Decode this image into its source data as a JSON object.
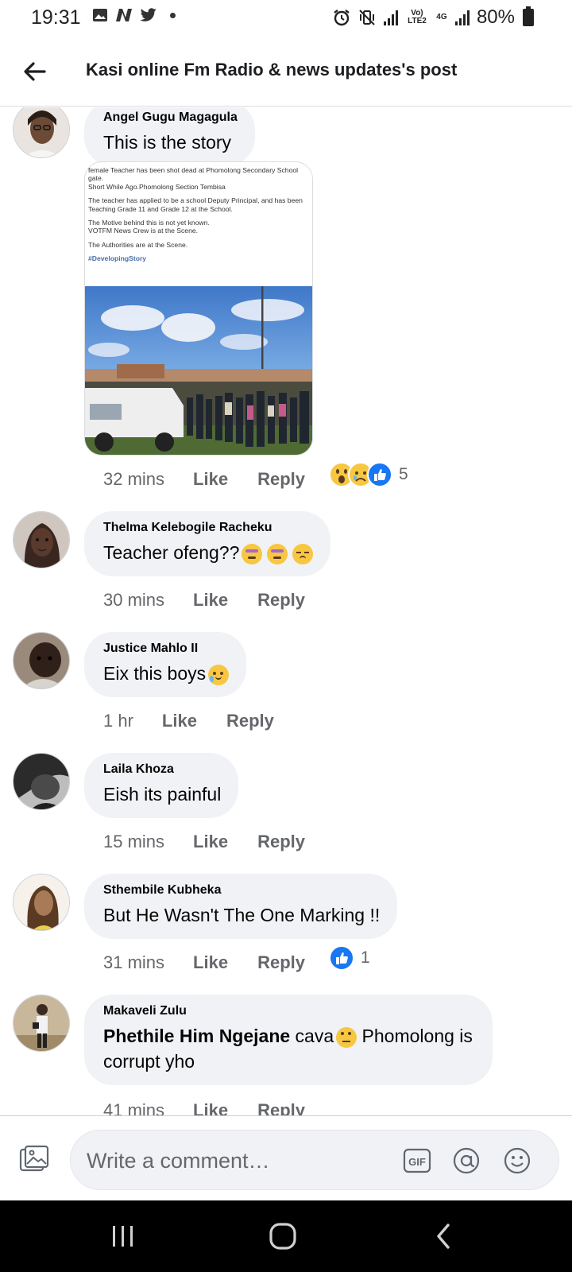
{
  "status_bar": {
    "time": "19:31",
    "battery": "80%",
    "volte": "Vo) LTE2",
    "network": "4G"
  },
  "header": {
    "title": "Kasi online Fm Radio & news updates's post"
  },
  "post_image": {
    "lines": [
      "female Teacher has been shot dead at Phomolong Secondary School gate.",
      "Short While Ago.Phomolong Section Tembisa",
      "The teacher has applied to be a school Deputy Principal, and has been Teaching Grade 11 and Grade 12 at the School.",
      "The Motive behind this is not yet known.",
      "VOTFM News  Crew is at the Scene.",
      "The Authorities are at the Scene."
    ],
    "hashtag": "#DevelopingStory"
  },
  "actions": {
    "like": "Like",
    "reply": "Reply"
  },
  "comments": [
    {
      "author": "Angel Gugu Magagula",
      "text": "This is the story",
      "time": "32 mins",
      "reaction_count": "5",
      "reactions": [
        "wow-icon",
        "sad-icon",
        "like-icon"
      ]
    },
    {
      "author": "Thelma Kelebogile Racheku",
      "text": "Teacher ofeng??",
      "time": "30 mins",
      "emojis": [
        "dizzy-face-icon",
        "dizzy-face-icon",
        "pensive-face-icon"
      ]
    },
    {
      "author": "Justice Mahlo II",
      "text": "Eix this boys",
      "time": "1 hr",
      "emojis": [
        "crying-face-icon"
      ]
    },
    {
      "author": "Laila Khoza",
      "text": "Eish its painful",
      "time": "15 mins"
    },
    {
      "author": "Sthembile Kubheka",
      "text": "But He Wasn't The One Marking !!",
      "time": "31 mins",
      "reaction_count": "1",
      "reactions": [
        "like-icon"
      ]
    },
    {
      "author": "Makaveli Zulu",
      "mention": "Phethile Him Ngejane",
      "text_a": " cava",
      "text_b": " Phomolong is",
      "text_c": "corrupt yho",
      "time": "41 mins",
      "emojis": [
        "rolling-eyes-face-icon"
      ]
    }
  ],
  "compose": {
    "placeholder": "Write a comment…",
    "gif_label": "GIF"
  },
  "colors": {
    "bubble": "#f0f2f5",
    "meta_text": "#65676b",
    "like_blue": "#1877f2",
    "nav_bar": "#000000"
  }
}
